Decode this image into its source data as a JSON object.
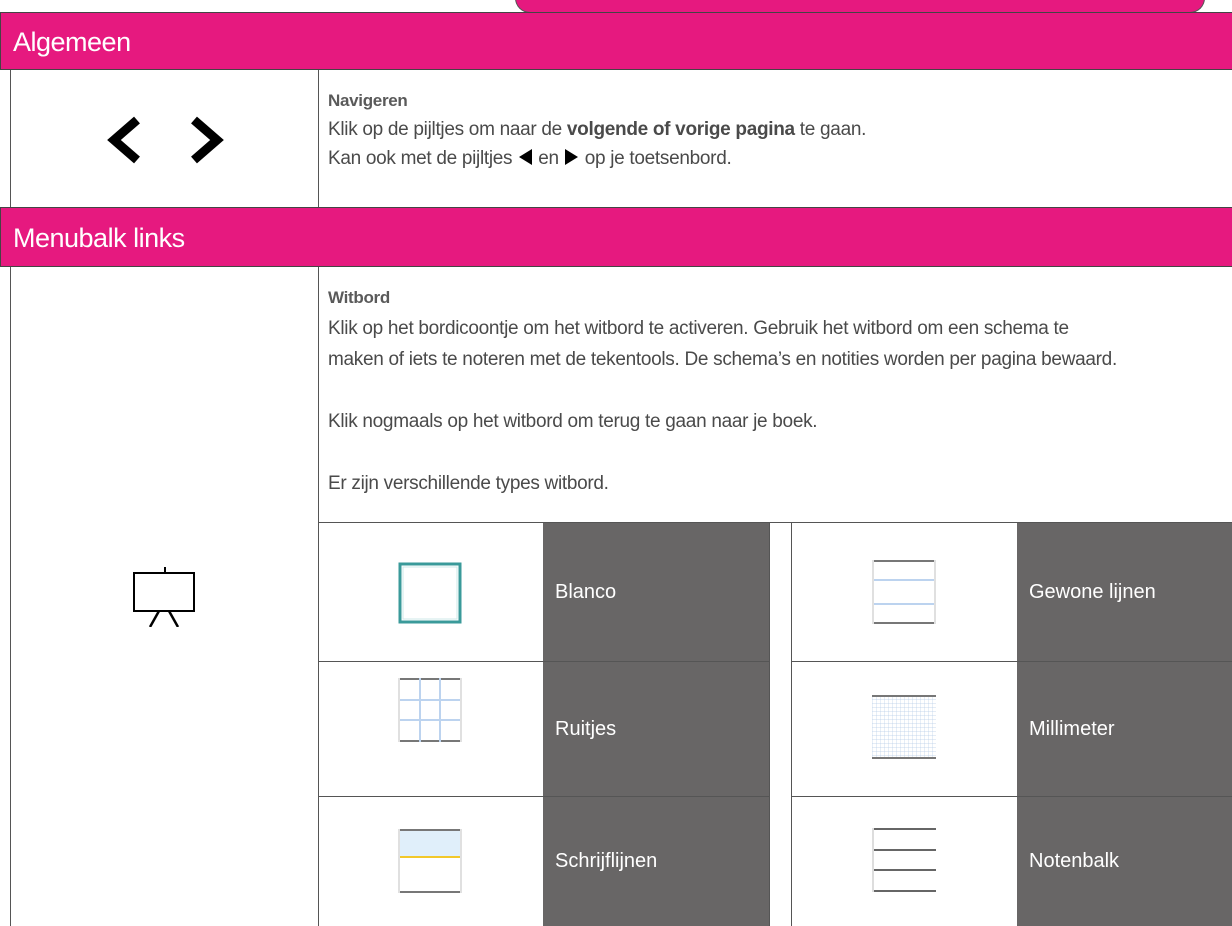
{
  "sections": {
    "general": {
      "title": "Algemeen",
      "nav": {
        "title": "Navigeren",
        "line1_pre": "Klik op de pijltjes om naar de ",
        "line1_bold": "volgende of vorige pagina",
        "line1_post": " te gaan.",
        "line2_pre": "Kan ook met de pijltjes ",
        "line2_mid": " en ",
        "line2_post": " op je toetsenbord."
      }
    },
    "menubar": {
      "title": "Menubalk links",
      "whiteboard": {
        "title": "Witbord",
        "p1_line1": "Klik op het bordicoontje om het witbord te activeren. Gebruik het witbord om een schema te",
        "p1_line2": "maken of iets te noteren met de tekentools. De schema’s en notities worden per pagina bewaard.",
        "p2": "Klik nogmaals op het witbord om terug te gaan naar je boek.",
        "p3": "Er zijn verschillende types witbord."
      },
      "types": [
        {
          "label": "Blanco",
          "icon": "blank-board-icon"
        },
        {
          "label": "Gewone lijnen",
          "icon": "lined-board-icon"
        },
        {
          "label": "Ruitjes",
          "icon": "grid-board-icon"
        },
        {
          "label": "Millimeter",
          "icon": "millimeter-board-icon"
        },
        {
          "label": "Schrijflijnen",
          "icon": "writing-lines-board-icon"
        },
        {
          "label": "Notenbalk",
          "icon": "staff-board-icon"
        }
      ]
    }
  },
  "colors": {
    "accent": "#e6197f",
    "dark_cell": "#686666"
  }
}
